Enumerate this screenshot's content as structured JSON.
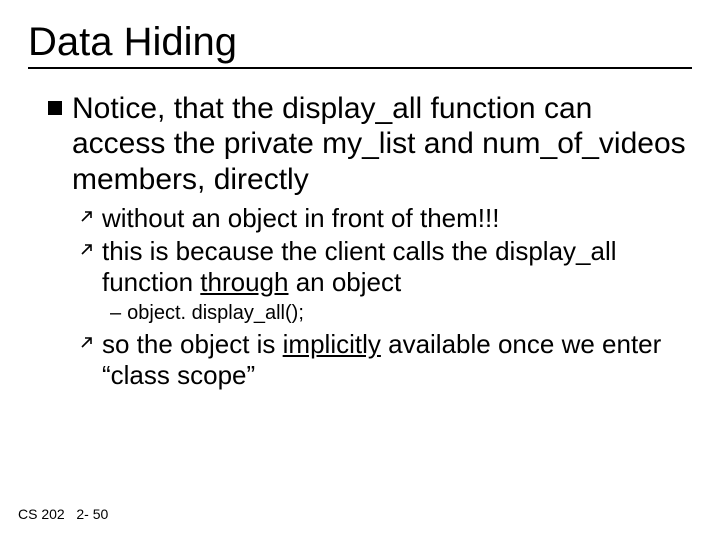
{
  "title": "Data Hiding",
  "l1": {
    "p0": "Notice, that the display_all function can access the private my_list and num_of_videos members, directly"
  },
  "l2": {
    "a": "without an object in front of them!!!",
    "b_pre": "this is because the client calls the display_all function ",
    "b_u": "through",
    "b_post": " an object",
    "c_pre": "so the object is ",
    "c_u": "implicitly",
    "c_post": " available once we enter “class scope”"
  },
  "l3": {
    "a": "object. display_all();"
  },
  "footer": {
    "course": "CS 202",
    "page": "2- 50"
  }
}
